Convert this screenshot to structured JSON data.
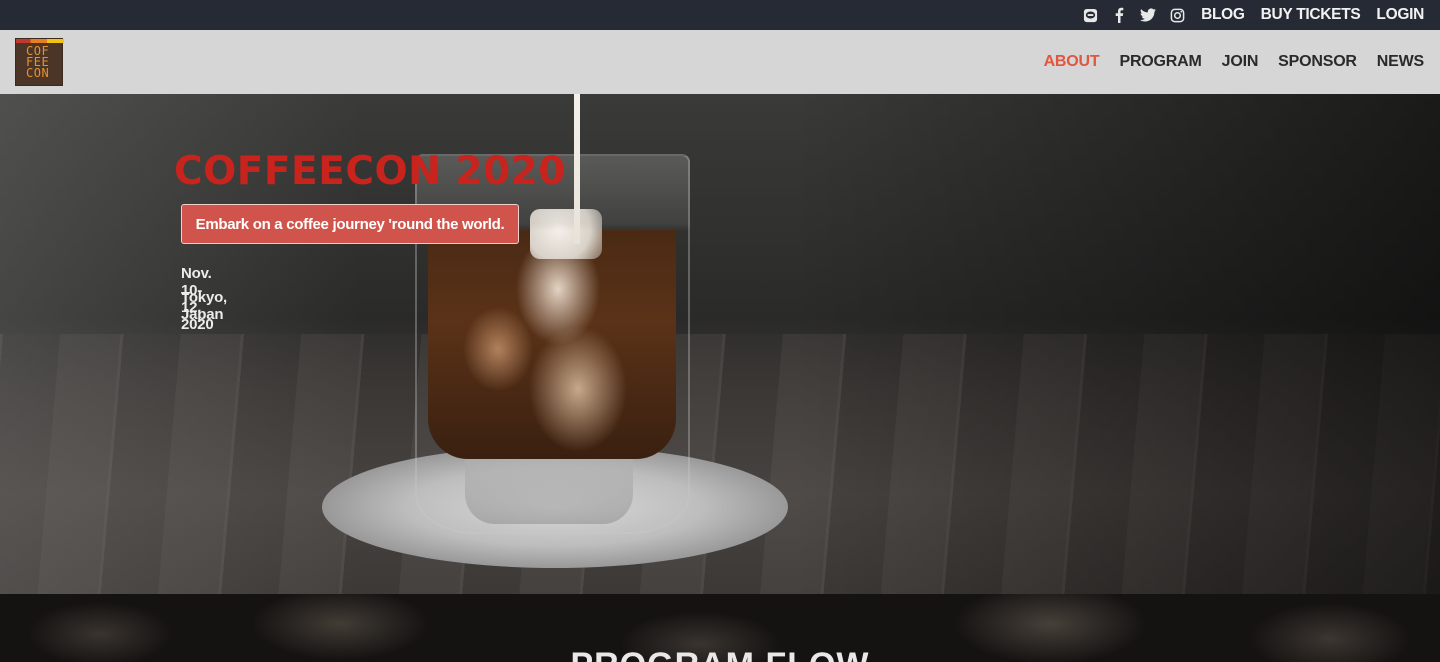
{
  "topbar": {
    "social_icons": [
      "line-icon",
      "facebook-icon",
      "twitter-icon",
      "instagram-icon"
    ],
    "links": [
      {
        "label": "BLOG"
      },
      {
        "label": "BUY TICKETS"
      },
      {
        "label": "LOGIN"
      }
    ]
  },
  "logo": {
    "lines": [
      "COF",
      "FEE",
      "CON"
    ]
  },
  "nav": {
    "items": [
      {
        "label": "ABOUT",
        "active": true
      },
      {
        "label": "PROGRAM",
        "active": false
      },
      {
        "label": "JOIN",
        "active": false
      },
      {
        "label": "SPONSOR",
        "active": false
      },
      {
        "label": "NEWS",
        "active": false
      }
    ]
  },
  "hero": {
    "title": "COFFEECON 2020",
    "tagline": "Embark on a coffee journey 'round the world.",
    "date": "Nov. 10-12, 2020",
    "place": "Tokyo, Japan"
  },
  "program": {
    "heading": "PROGRAM FLOW"
  },
  "colors": {
    "topbar_bg": "#252a35",
    "navbar_bg": "#d6d6d6",
    "active_nav": "#e2553e",
    "title_red": "#c8231c",
    "tagline_bg": "#d0544b"
  }
}
